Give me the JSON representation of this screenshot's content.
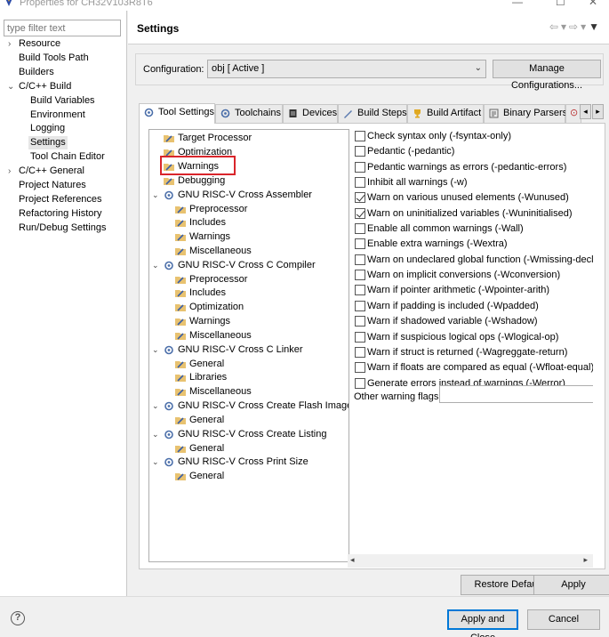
{
  "window": {
    "title": "Properties for CH32V103R8T6"
  },
  "filter": {
    "placeholder": "type filter text"
  },
  "nav": {
    "items": [
      {
        "label": "Resource"
      },
      {
        "label": "Build Tools Path"
      },
      {
        "label": "Builders"
      },
      {
        "label": "C/C++ Build"
      },
      {
        "label": "Build Variables"
      },
      {
        "label": "Environment"
      },
      {
        "label": "Logging"
      },
      {
        "label": "Settings"
      },
      {
        "label": "Tool Chain Editor"
      },
      {
        "label": "C/C++ General"
      },
      {
        "label": "Project Natures"
      },
      {
        "label": "Project References"
      },
      {
        "label": "Refactoring History"
      },
      {
        "label": "Run/Debug Settings"
      }
    ]
  },
  "page": {
    "title": "Settings"
  },
  "config": {
    "label": "Configuration:",
    "value": "obj  [ Active ]",
    "manage_label": "Manage Configurations..."
  },
  "tabs": [
    {
      "label": "Tool Settings"
    },
    {
      "label": "Toolchains"
    },
    {
      "label": "Devices"
    },
    {
      "label": "Build Steps"
    },
    {
      "label": "Build Artifact"
    },
    {
      "label": "Binary Parsers"
    }
  ],
  "tree": [
    {
      "label": "Target Processor"
    },
    {
      "label": "Optimization"
    },
    {
      "label": "Warnings"
    },
    {
      "label": "Debugging"
    },
    {
      "label": "GNU RISC-V Cross Assembler"
    },
    {
      "label": "Preprocessor"
    },
    {
      "label": "Includes"
    },
    {
      "label": "Warnings"
    },
    {
      "label": "Miscellaneous"
    },
    {
      "label": "GNU RISC-V Cross C Compiler"
    },
    {
      "label": "Preprocessor"
    },
    {
      "label": "Includes"
    },
    {
      "label": "Optimization"
    },
    {
      "label": "Warnings"
    },
    {
      "label": "Miscellaneous"
    },
    {
      "label": "GNU RISC-V Cross C Linker"
    },
    {
      "label": "General"
    },
    {
      "label": "Libraries"
    },
    {
      "label": "Miscellaneous"
    },
    {
      "label": "GNU RISC-V Cross Create Flash Image"
    },
    {
      "label": "General"
    },
    {
      "label": "GNU RISC-V Cross Create Listing"
    },
    {
      "label": "General"
    },
    {
      "label": "GNU RISC-V Cross Print Size"
    },
    {
      "label": "General"
    }
  ],
  "options": [
    {
      "label": "Check syntax only (-fsyntax-only)",
      "checked": false
    },
    {
      "label": "Pedantic (-pedantic)",
      "checked": false
    },
    {
      "label": "Pedantic warnings as errors (-pedantic-errors)",
      "checked": false
    },
    {
      "label": "Inhibit all warnings (-w)",
      "checked": false
    },
    {
      "label": "Warn on various unused elements (-Wunused)",
      "checked": true
    },
    {
      "label": "Warn on uninitialized variables (-Wuninitialised)",
      "checked": true
    },
    {
      "label": "Enable all common warnings (-Wall)",
      "checked": false
    },
    {
      "label": "Enable extra warnings (-Wextra)",
      "checked": false
    },
    {
      "label": "Warn on undeclared global function (-Wmissing-declara",
      "checked": false
    },
    {
      "label": "Warn on implicit conversions (-Wconversion)",
      "checked": false
    },
    {
      "label": "Warn if pointer arithmetic (-Wpointer-arith)",
      "checked": false
    },
    {
      "label": "Warn if padding is included (-Wpadded)",
      "checked": false
    },
    {
      "label": "Warn if shadowed variable (-Wshadow)",
      "checked": false
    },
    {
      "label": "Warn if suspicious logical ops (-Wlogical-op)",
      "checked": false
    },
    {
      "label": "Warn if struct is returned (-Wagreggate-return)",
      "checked": false
    },
    {
      "label": "Warn if floats are compared as equal (-Wfloat-equal)",
      "checked": false
    },
    {
      "label": "Generate errors instead of warnings (-Werror)",
      "checked": false
    }
  ],
  "other_flags": {
    "label": "Other warning flags",
    "value": ""
  },
  "buttons": {
    "restore": "Restore Defaults",
    "apply": "Apply",
    "apply_close": "Apply and Close",
    "cancel": "Cancel",
    "help": "?"
  },
  "colors": {
    "highlight": "#d9252b",
    "default_button_border": "#0078d7"
  }
}
